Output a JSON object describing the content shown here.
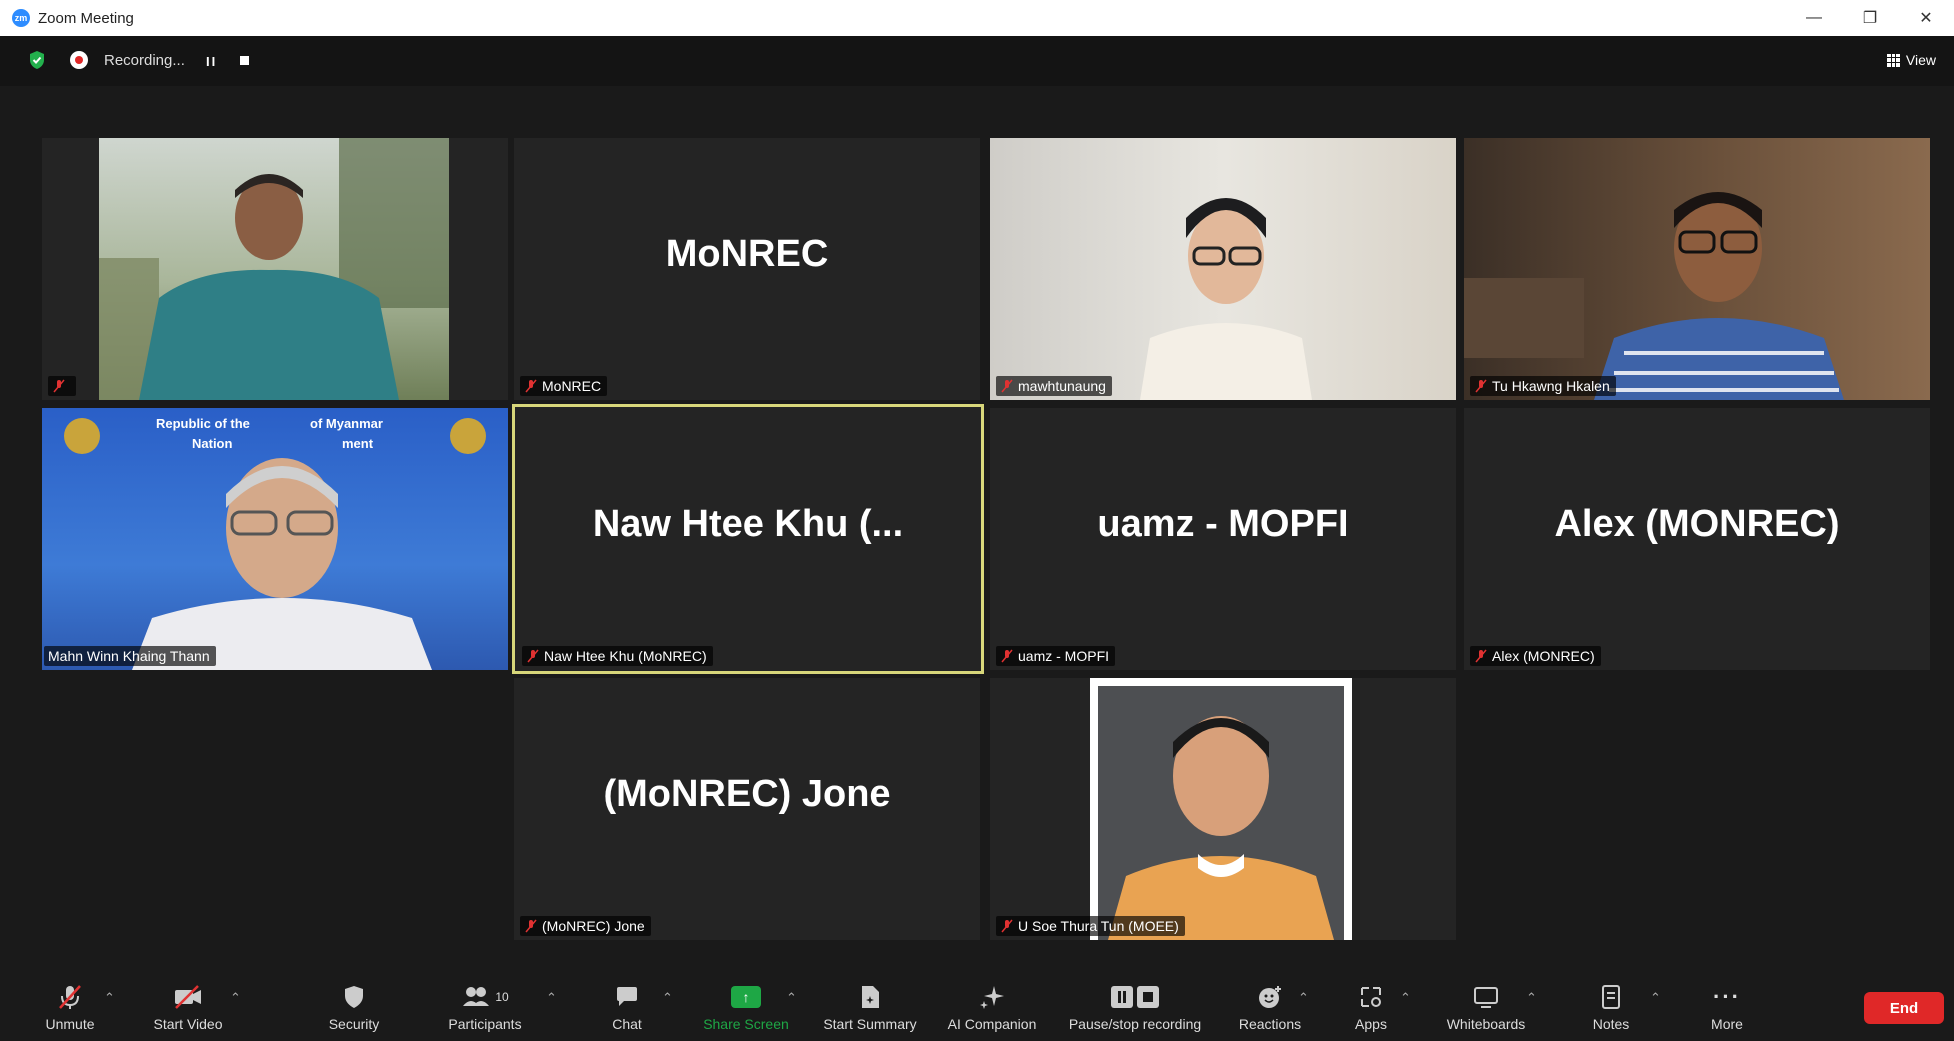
{
  "window": {
    "title": "Zoom Meeting",
    "logo_text": "zm"
  },
  "topbar": {
    "recording_text": "Recording...",
    "view_label": "View"
  },
  "participants": [
    {
      "label": "",
      "display_name": "",
      "type": "video"
    },
    {
      "label": "MoNREC",
      "display_name": "MoNREC",
      "type": "name"
    },
    {
      "label": "mawhtunaung",
      "display_name": "",
      "type": "video"
    },
    {
      "label": "Tu Hkawng Hkalen",
      "display_name": "",
      "type": "video"
    },
    {
      "label": "Mahn Winn Khaing Thann",
      "display_name": "",
      "type": "video",
      "banner_line1": "Republic of the",
      "banner_line1b": "of Myanmar",
      "banner_line2": "Nation",
      "banner_line2b": "ment"
    },
    {
      "label": "Naw Htee Khu (MoNREC)",
      "display_name": "Naw Htee Khu (...",
      "type": "name",
      "active": true
    },
    {
      "label": "uamz - MOPFI",
      "display_name": "uamz - MOPFI",
      "type": "name"
    },
    {
      "label": "Alex (MONREC)",
      "display_name": "Alex (MONREC)",
      "type": "name"
    },
    {
      "label": "(MoNREC) Jone",
      "display_name": "(MoNREC) Jone",
      "type": "name"
    },
    {
      "label": "U Soe Thura Tun (MOEE)",
      "display_name": "",
      "type": "video"
    }
  ],
  "toolbar": {
    "unmute": "Unmute",
    "start_video": "Start Video",
    "security": "Security",
    "participants": "Participants",
    "participants_count": "10",
    "chat": "Chat",
    "share_screen": "Share Screen",
    "start_summary": "Start Summary",
    "ai_companion": "AI Companion",
    "pause_recording": "Pause/stop recording",
    "reactions": "Reactions",
    "apps": "Apps",
    "whiteboards": "Whiteboards",
    "notes": "Notes",
    "more": "More",
    "end": "End"
  },
  "colors": {
    "end_red": "#e02828",
    "share_green": "#1ea745",
    "active_outline": "#d7d67a"
  }
}
